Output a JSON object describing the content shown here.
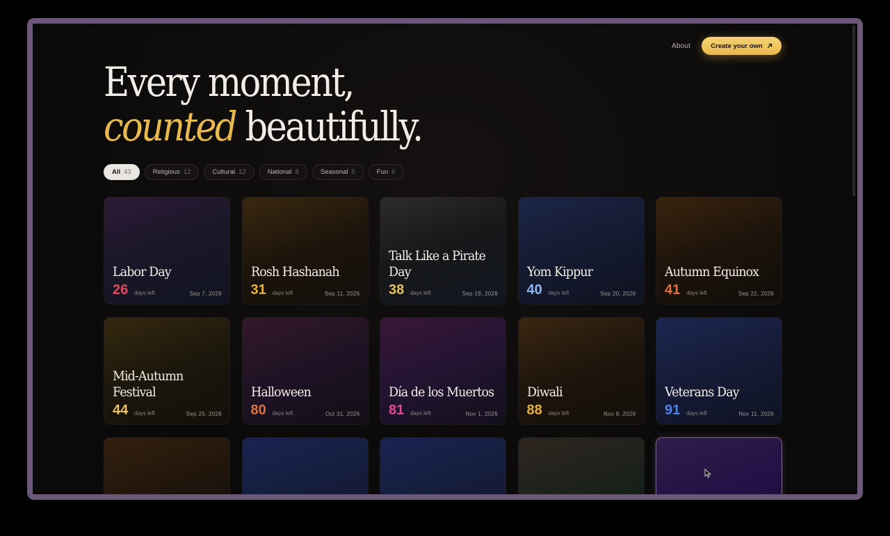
{
  "nav": {
    "about": "About",
    "cta": "Create your own",
    "cta_icon": "arrow-up-right-icon"
  },
  "hero": {
    "line1": "Every moment,",
    "accent": "counted",
    "line2_rest": " beautifully."
  },
  "filters": [
    {
      "label": "All",
      "count": "43"
    },
    {
      "label": "Religious",
      "count": "12"
    },
    {
      "label": "Cultural",
      "count": "12"
    },
    {
      "label": "National",
      "count": "8"
    },
    {
      "label": "Seasonal",
      "count": "5"
    },
    {
      "label": "Fun",
      "count": "6"
    }
  ],
  "colors": {
    "accent": "#e8b94f",
    "red": "#e5485e",
    "amber": "#e9b13d",
    "sky": "#8fb7ef",
    "orange": "#e0703c",
    "pink": "#e2498f",
    "blue": "#4f7fe8"
  },
  "cards": [
    {
      "title": "Labor Day",
      "count": "26",
      "days": "days left",
      "date": "Sep 7, 2026",
      "color": "#e5485e",
      "bg": "linear-gradient(160deg,#2e1a36 0%,#1a1729 45%,#111420 100%)"
    },
    {
      "title": "Rosh Hashanah",
      "count": "31",
      "days": "days left",
      "date": "Sep 11, 2026",
      "color": "#e9b13d",
      "bg": "linear-gradient(160deg,#3a2810 0%,#1c140b 50%,#120f0b 100%)"
    },
    {
      "title": "Talk Like a Pirate Day",
      "count": "38",
      "days": "days left",
      "date": "Sep 19, 2026",
      "color": "#e9c15a",
      "bg": "linear-gradient(160deg,#2e2c2a 0%,#171819 45%,#101520 100%)"
    },
    {
      "title": "Yom Kippur",
      "count": "40",
      "days": "days left",
      "date": "Sep 20, 2026",
      "color": "#8fb7ef",
      "bg": "linear-gradient(160deg,#1c2548 0%,#141a30 50%,#0f1220 100%)"
    },
    {
      "title": "Autumn Equinox",
      "count": "41",
      "days": "days left",
      "date": "Sep 22, 2026",
      "color": "#e0703c",
      "bg": "linear-gradient(160deg,#3a230e 0%,#1c130b 50%,#110d0a 100%)"
    },
    {
      "title": "Mid-Autumn Festival",
      "count": "44",
      "days": "days left",
      "date": "Sep 25, 2026",
      "color": "#e9c15a",
      "bg": "linear-gradient(160deg,#34280f 0%,#1c170c 50%,#110f0b 100%)"
    },
    {
      "title": "Halloween",
      "count": "80",
      "days": "days left",
      "date": "Oct 31, 2026",
      "color": "#e0703c",
      "bg": "linear-gradient(160deg,#331829 0%,#1e1224 50%,#120e17 100%)"
    },
    {
      "title": "Día de los Muertos",
      "count": "81",
      "days": "days left",
      "date": "Nov 1, 2026",
      "color": "#e2498f",
      "bg": "linear-gradient(160deg,#3a1638 0%,#221431 50%,#130f1c 100%)"
    },
    {
      "title": "Diwali",
      "count": "88",
      "days": "days left",
      "date": "Nov 8, 2026",
      "color": "#e9b13d",
      "bg": "linear-gradient(160deg,#3a2610 0%,#1e150c 50%,#120e0a 100%)"
    },
    {
      "title": "Veterans Day",
      "count": "91",
      "days": "days left",
      "date": "Nov 11, 2026",
      "color": "#4f7fe8",
      "bg": "linear-gradient(160deg,#1c2650 0%,#151b36 50%,#0f1222 100%)"
    },
    {
      "title": "",
      "count": "",
      "days": "",
      "date": "",
      "color": "#e0703c",
      "bg": "linear-gradient(160deg,#33200e 0%,#1c130b 60%,#110d0a 100%)"
    },
    {
      "title": "",
      "count": "",
      "days": "",
      "date": "",
      "color": "#4f7fe8",
      "bg": "linear-gradient(160deg,#1a2450 0%,#141b38 60%,#0f1222 100%)"
    },
    {
      "title": "",
      "count": "",
      "days": "",
      "date": "",
      "color": "#4f7fe8",
      "bg": "linear-gradient(160deg,#1a2450 0%,#141b38 60%,#0f1222 100%)"
    },
    {
      "title": "",
      "count": "",
      "days": "",
      "date": "",
      "color": "#6fbf7a",
      "bg": "linear-gradient(160deg,#2e2520 0%,#18201a 60%,#101411 100%)"
    },
    {
      "title": "",
      "count": "",
      "days": "",
      "date": "",
      "color": "#a070e0",
      "bg": "linear-gradient(160deg,#2e1d48 0%,#241045 55%,#170c2b 100%)"
    }
  ]
}
